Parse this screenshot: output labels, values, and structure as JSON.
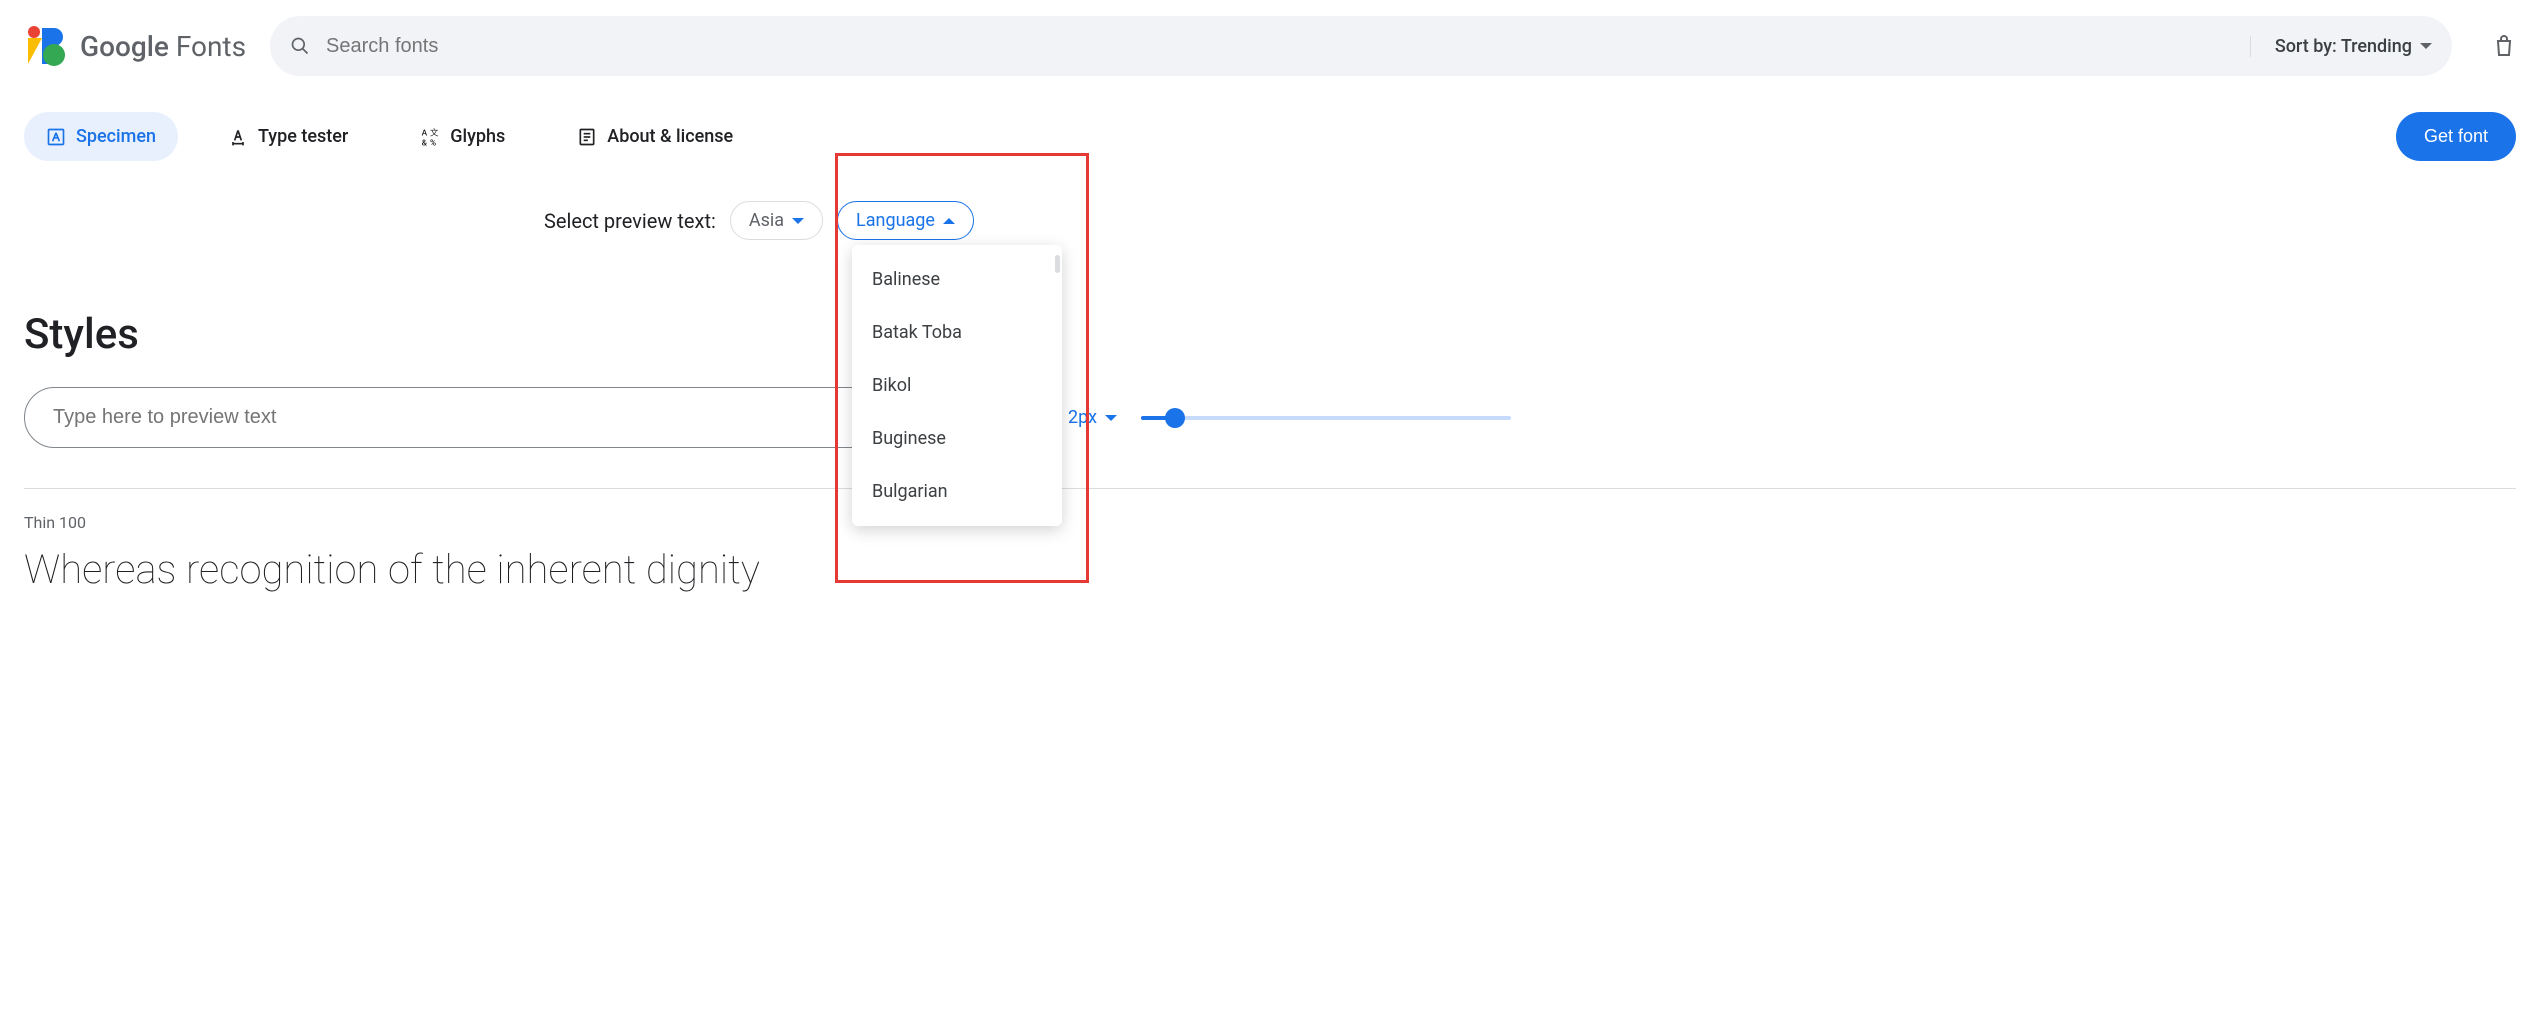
{
  "header": {
    "brand_strong": "Google",
    "brand_light": "Fonts",
    "search_placeholder": "Search fonts",
    "sort_prefix": "Sort by:",
    "sort_value": "Trending"
  },
  "tabs": {
    "specimen": "Specimen",
    "type_tester": "Type tester",
    "glyphs": "Glyphs",
    "about": "About & license",
    "get_font": "Get font"
  },
  "preview": {
    "label": "Select preview text:",
    "region_chip": "Asia",
    "language_chip": "Language",
    "dropdown": [
      "Balinese",
      "Batak Toba",
      "Bikol",
      "Buginese",
      "Bulgarian"
    ]
  },
  "styles": {
    "heading": "Styles",
    "input_placeholder": "Type here to preview text",
    "size_value": "2px",
    "weight_label": "Thin 100",
    "sample_text": "Whereas recognition of the inherent dignity"
  }
}
